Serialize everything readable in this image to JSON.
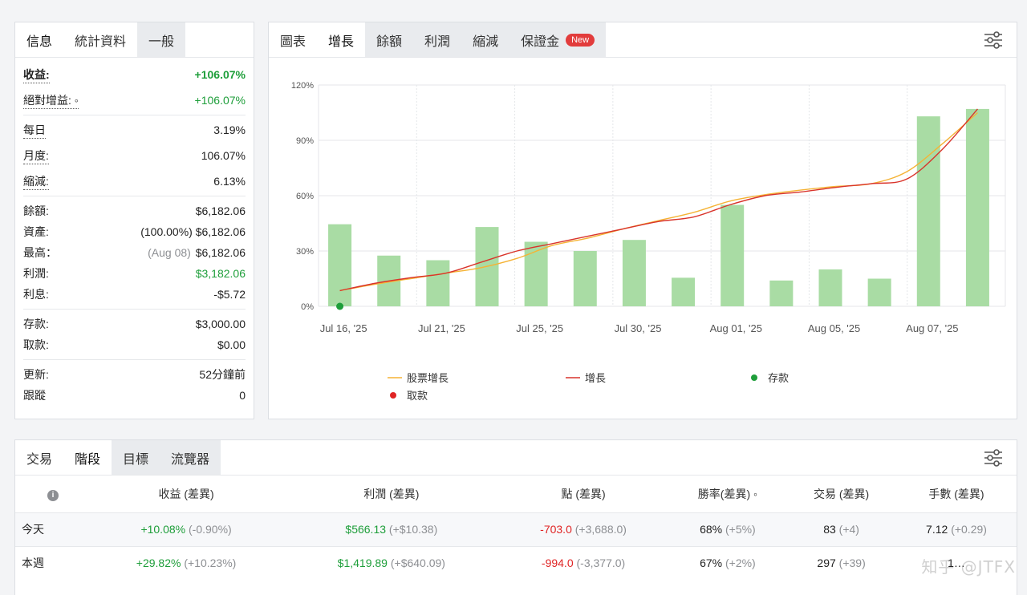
{
  "left_panel": {
    "tabs": [
      {
        "label": "信息",
        "active": true
      },
      {
        "label": "統計資料",
        "active": false
      },
      {
        "label": "一般",
        "active": false
      }
    ],
    "gain_label": "收益:",
    "gain_value": "+106.07%",
    "abs_gain_label": "絕對增益: ◦",
    "abs_gain_value": "+106.07%",
    "daily_label": "每日",
    "daily_value": "3.19%",
    "monthly_label": "月度:",
    "monthly_value": "106.07%",
    "drawdown_label": "縮減:",
    "drawdown_value": "6.13%",
    "balance_label": "餘額:",
    "balance_value": "$6,182.06",
    "equity_label": "資產:",
    "equity_pct": "(100.00%)",
    "equity_value": "$6,182.06",
    "highest_label": "最高：",
    "highest_date": "(Aug 08)",
    "highest_value": "$6,182.06",
    "profit_label": "利潤:",
    "profit_value": "$3,182.06",
    "interest_label": "利息:",
    "interest_value": "-$5.72",
    "deposits_label": "存款:",
    "deposits_value": "$3,000.00",
    "withdrawals_label": "取款:",
    "withdrawals_value": "$0.00",
    "updated_label": "更新:",
    "updated_value": "52分鐘前",
    "tracking_label": "跟蹤",
    "tracking_value": "0"
  },
  "chart_panel": {
    "tabs": [
      {
        "label": "圖表",
        "active": false
      },
      {
        "label": "增長",
        "active": true
      },
      {
        "label": "餘額",
        "active": false
      },
      {
        "label": "利潤",
        "active": false
      },
      {
        "label": "縮減",
        "active": false
      },
      {
        "label": "保證金",
        "active": false,
        "badge": "New"
      }
    ],
    "settings_icon": "sliders-icon"
  },
  "chart_data": {
    "type": "bar",
    "x_tick_labels": [
      "Jul 16, '25",
      "Jul 21, '25",
      "Jul 25, '25",
      "Jul 30, '25",
      "Aug 01, '25",
      "Aug 05, '25",
      "Aug 07, '25"
    ],
    "y_tick_labels": [
      "0%",
      "30%",
      "60%",
      "90%",
      "120%"
    ],
    "ylim": [
      0,
      120
    ],
    "bars": [
      44.5,
      27.5,
      25,
      43,
      35,
      30,
      36,
      15.5,
      55,
      14,
      20,
      15,
      103,
      107
    ],
    "bar_color": "#a9dca4",
    "series": [
      {
        "name": "股票增長",
        "color": "#f5b335",
        "values": [
          8.5,
          12,
          15,
          18,
          21,
          26,
          33,
          37,
          42,
          46.5,
          51,
          57,
          60.5,
          63,
          65,
          66.5,
          73,
          88,
          105
        ]
      },
      {
        "name": "增長",
        "color": "#d9342b",
        "values": [
          8.5,
          12.5,
          15.5,
          18,
          24,
          30,
          34,
          38,
          42,
          46,
          48.5,
          55,
          60,
          62,
          64.5,
          66.5,
          69,
          85,
          107
        ]
      }
    ],
    "deposit_points": [
      [
        0,
        0
      ]
    ],
    "legend": [
      {
        "label": "股票增長",
        "kind": "line",
        "color": "#f5b335"
      },
      {
        "label": "增長",
        "kind": "line",
        "color": "#d9342b"
      },
      {
        "label": "存款",
        "kind": "dot",
        "color": "#1e9e3a"
      },
      {
        "label": "取款",
        "kind": "dot",
        "color": "#e02424"
      }
    ],
    "grid": true,
    "legend_position": "bottom"
  },
  "bottom_panel": {
    "tabs": [
      {
        "label": "交易",
        "active": false
      },
      {
        "label": "階段",
        "active": true
      },
      {
        "label": "目標",
        "active": false
      },
      {
        "label": "流覽器",
        "active": false
      }
    ],
    "headers": [
      "收益 (差異)",
      "利潤 (差異)",
      "點 (差異)",
      "勝率(差異) ◦",
      "交易 (差異)",
      "手數 (差異)"
    ],
    "rows": [
      {
        "period": "今天",
        "gain": "+10.08%",
        "gain_diff": "(-0.90%)",
        "profit": "$566.13",
        "profit_diff": "(+$10.38)",
        "pips": "-703.0",
        "pips_diff": "(+3,688.0)",
        "winrate": "68%",
        "winrate_diff": "(+5%)",
        "trades": "83",
        "trades_diff": "(+4)",
        "lots": "7.12",
        "lots_diff": "(+0.29)"
      },
      {
        "period": "本週",
        "gain": "+29.82%",
        "gain_diff": "(+10.23%)",
        "profit": "$1,419.89",
        "profit_diff": "(+$640.09)",
        "pips": "-994.0",
        "pips_diff": "(-3,377.0)",
        "winrate": "67%",
        "winrate_diff": "(+2%)",
        "trades": "297",
        "trades_diff": "(+39)",
        "lots": "1…",
        "lots_diff": ""
      }
    ]
  },
  "watermark": "知乎 @JTFX"
}
